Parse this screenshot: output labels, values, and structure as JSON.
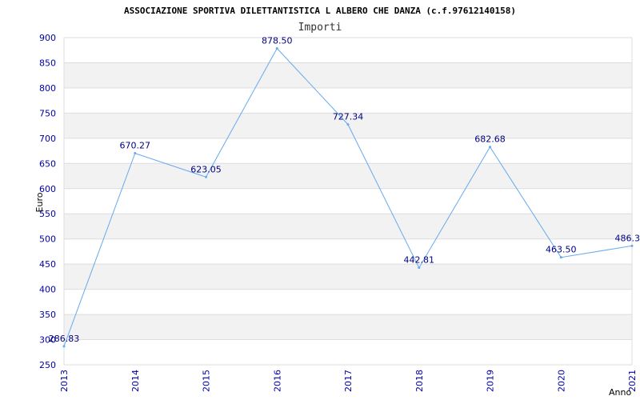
{
  "chart_data": {
    "type": "line",
    "title": "ASSOCIAZIONE SPORTIVA DILETTANTISTICA L ALBERO CHE DANZA (c.f.97612140158)",
    "subtitle": "Importi",
    "xlabel": "Anno",
    "ylabel": "Euro",
    "x": [
      "2013",
      "2014",
      "2015",
      "2016",
      "2017",
      "2018",
      "2019",
      "2020",
      "2021"
    ],
    "series": [
      {
        "values": [
          286.83,
          670.27,
          623.05,
          878.5,
          727.34,
          442.81,
          682.68,
          463.5,
          486.3
        ],
        "labels": [
          "286.83",
          "670.27",
          "623.05",
          "878.50",
          "727.34",
          "442.81",
          "682.68",
          "463.50",
          "486.3"
        ]
      }
    ],
    "ylim": [
      250,
      900
    ],
    "yticks": [
      "250",
      "300",
      "350",
      "400",
      "450",
      "500",
      "550",
      "600",
      "650",
      "700",
      "750",
      "800",
      "850",
      "900"
    ],
    "grid": true,
    "colors": {
      "line": "#66aaee",
      "band": "#f2f2f2",
      "grid": "#dddddd",
      "tick_text": "#0000aa",
      "data_label": "#000080"
    }
  }
}
